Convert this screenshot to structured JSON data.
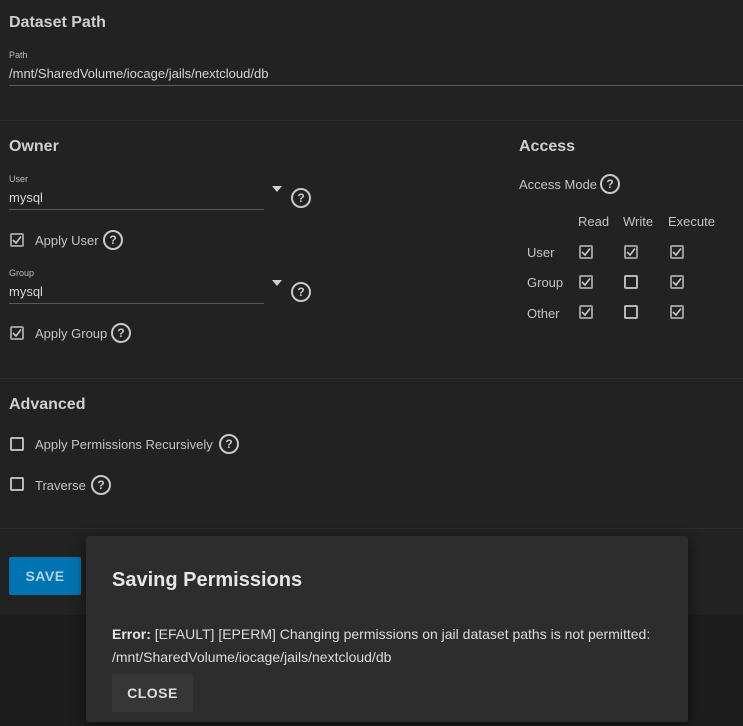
{
  "dataset_path": {
    "title": "Dataset Path",
    "path_label": "Path",
    "path_value": "/mnt/SharedVolume/iocage/jails/nextcloud/db"
  },
  "owner": {
    "title": "Owner",
    "user_label": "User",
    "user_value": "mysql",
    "apply_user_label": "Apply User",
    "apply_user_checked": true,
    "group_label": "Group",
    "group_value": "mysql",
    "apply_group_label": "Apply Group",
    "apply_group_checked": true
  },
  "access": {
    "title": "Access",
    "mode_label": "Access Mode",
    "columns": [
      "Read",
      "Write",
      "Execute"
    ],
    "rows": [
      {
        "label": "User",
        "values": [
          true,
          true,
          true
        ]
      },
      {
        "label": "Group",
        "values": [
          true,
          false,
          true
        ]
      },
      {
        "label": "Other",
        "values": [
          true,
          false,
          true
        ]
      }
    ]
  },
  "advanced": {
    "title": "Advanced",
    "recursive_label": "Apply Permissions Recursively",
    "recursive_checked": false,
    "traverse_label": "Traverse",
    "traverse_checked": false
  },
  "actions": {
    "save_label": "SAVE"
  },
  "dialog": {
    "title": "Saving Permissions",
    "error_prefix": "Error:",
    "error_message": "[EFAULT] [EPERM] Changing permissions on jail dataset paths is not permitted: /mnt/SharedVolume/iocage/jails/nextcloud/db",
    "close_label": "CLOSE"
  },
  "icons": {
    "help": "help-circle-icon",
    "dropdown": "triangle-down-icon",
    "check": "check-icon"
  },
  "colors": {
    "accent": "#0073b2",
    "background": "#222222",
    "dialog": "#2d2d2d"
  }
}
